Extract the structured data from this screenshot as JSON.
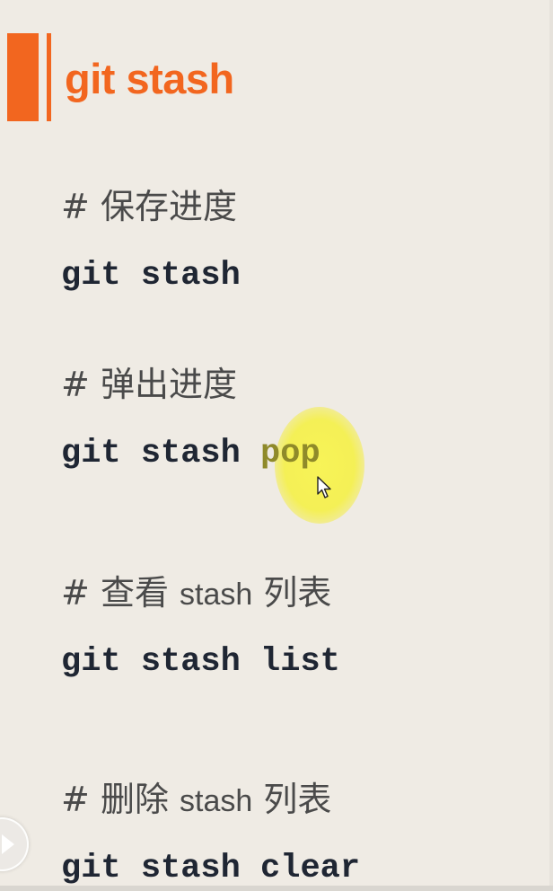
{
  "slide": {
    "title": "git stash",
    "sections": [
      {
        "comment_hash": "#",
        "comment_text": "保存进度",
        "command": "git stash"
      },
      {
        "comment_hash": "#",
        "comment_text": "弹出进度",
        "command_prefix": "git stash ",
        "command_highlight": "pop"
      },
      {
        "comment_hash": "#",
        "comment_text_a": "查看",
        "comment_latin": "stash",
        "comment_text_b": "列表",
        "command": "git stash list"
      },
      {
        "comment_hash": "#",
        "comment_text_a": "删除",
        "comment_latin": "stash",
        "comment_text_b": "列表",
        "command": "git stash clear"
      }
    ]
  },
  "colors": {
    "accent": "#f2661f",
    "background": "#efebe4",
    "command_text": "#1f2633",
    "comment_text": "#4a4a4a",
    "cursor_highlight": "#f5f046"
  },
  "icons": {
    "cursor": "cursor-arrow-icon",
    "play": "play-icon"
  }
}
